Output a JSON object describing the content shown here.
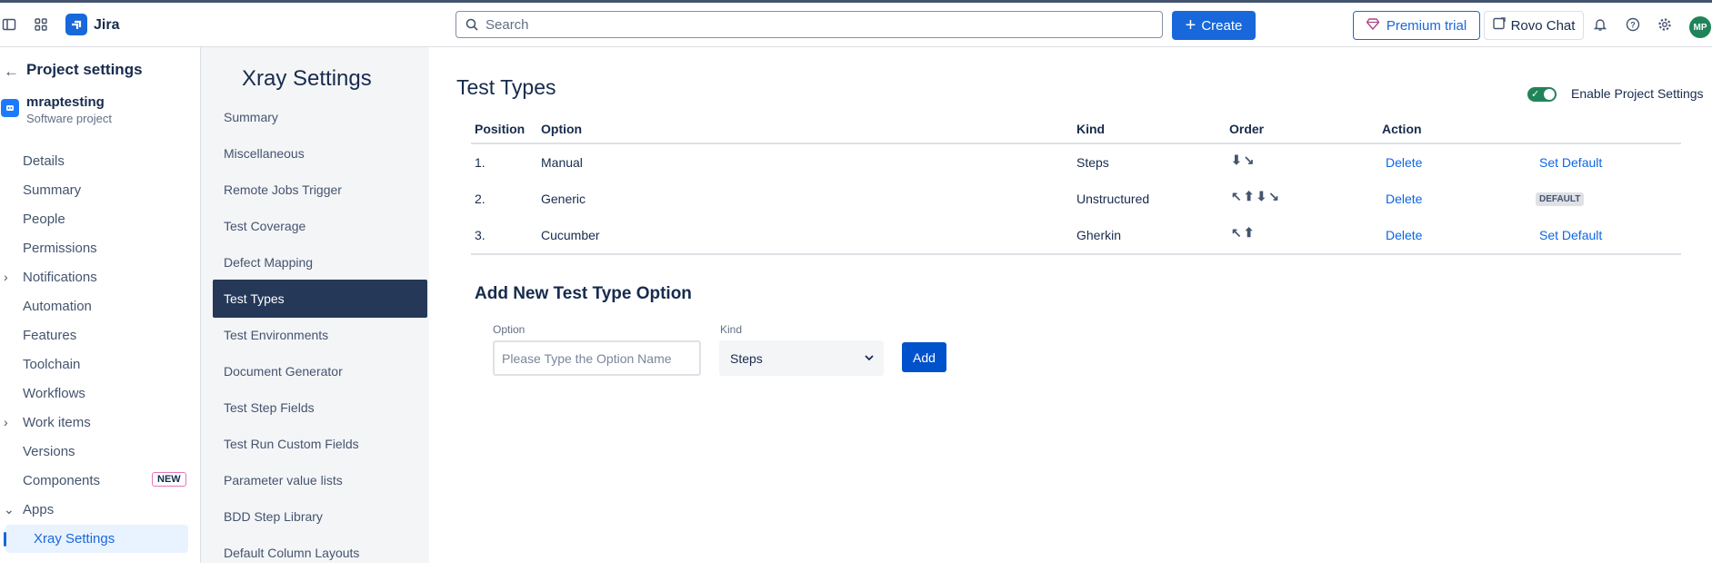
{
  "topbar": {
    "app_name": "Jira",
    "search_placeholder": "Search",
    "create_label": "Create",
    "premium_label": "Premium trial",
    "rovo_label": "Rovo Chat",
    "avatar_initials": "MP"
  },
  "sidebar": {
    "title": "Project settings",
    "project_name": "mraptesting",
    "project_type": "Software project",
    "items": [
      {
        "label": "Details"
      },
      {
        "label": "Summary"
      },
      {
        "label": "People"
      },
      {
        "label": "Permissions"
      },
      {
        "label": "Notifications"
      },
      {
        "label": "Automation"
      },
      {
        "label": "Features"
      },
      {
        "label": "Toolchain"
      },
      {
        "label": "Workflows"
      },
      {
        "label": "Work items"
      },
      {
        "label": "Versions"
      },
      {
        "label": "Components",
        "badge": "NEW"
      },
      {
        "label": "Apps"
      },
      {
        "label": "Xray Settings"
      }
    ]
  },
  "xray": {
    "title": "Xray Settings",
    "items": [
      "Summary",
      "Miscellaneous",
      "Remote Jobs Trigger",
      "Test Coverage",
      "Defect Mapping",
      "Test Types",
      "Test Environments",
      "Document Generator",
      "Test Step Fields",
      "Test Run Custom Fields",
      "Parameter value lists",
      "BDD Step Library",
      "Default Column Layouts"
    ]
  },
  "main": {
    "title": "Test Types",
    "toggle_label": "Enable Project Settings",
    "headers": [
      "Position",
      "Option",
      "Kind",
      "Order",
      "Action"
    ],
    "rows": [
      {
        "position": "1.",
        "option": "Manual",
        "kind": "Steps",
        "order": "⬇↘",
        "delete": "Delete",
        "extra": "Set Default"
      },
      {
        "position": "2.",
        "option": "Generic",
        "kind": "Unstructured",
        "order": "↖⬆⬇↘",
        "delete": "Delete",
        "extra": "DEFAULT"
      },
      {
        "position": "3.",
        "option": "Cucumber",
        "kind": "Gherkin",
        "order": "↖⬆",
        "delete": "Delete",
        "extra": "Set Default"
      }
    ],
    "add_title": "Add New Test Type Option",
    "option_label": "Option",
    "option_placeholder": "Please Type the Option Name",
    "kind_label": "Kind",
    "kind_value": "Steps",
    "add_button": "Add"
  },
  "colors": {
    "brand": "#1868db",
    "active_nav": "#253858",
    "link": "#0c66e4",
    "toggle_on": "#1f845a"
  }
}
